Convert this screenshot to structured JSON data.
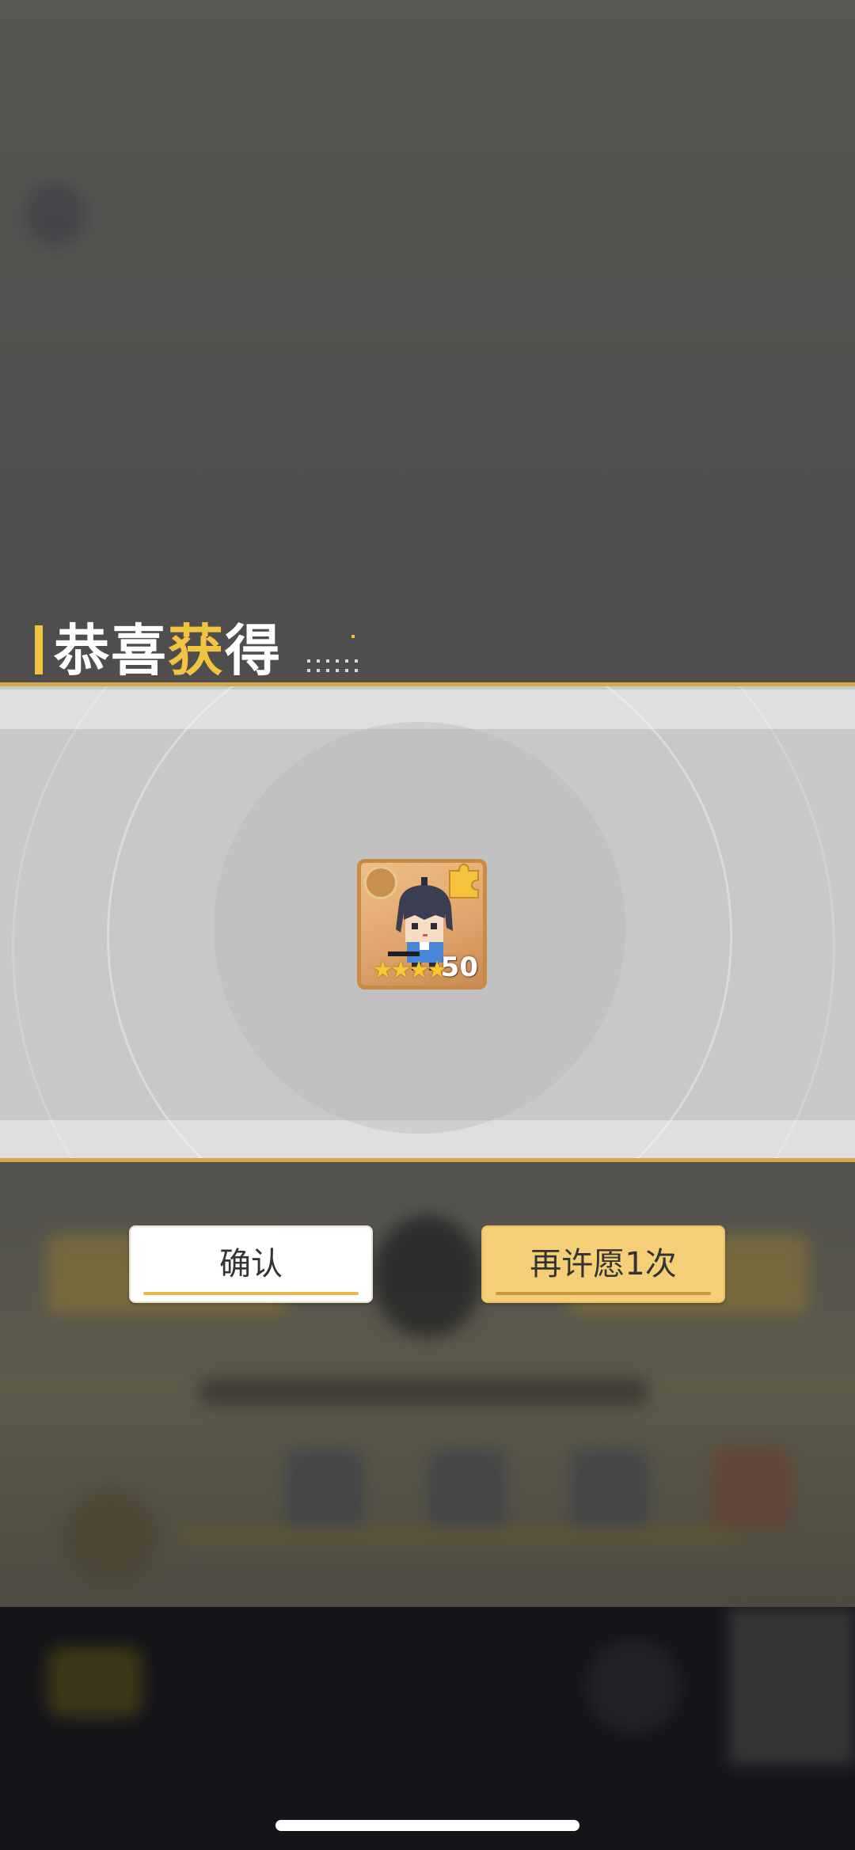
{
  "reward": {
    "title_white_1": "恭喜",
    "title_yellow": "获",
    "title_white_2": "得",
    "item": {
      "stars": "★★★★",
      "count": "50",
      "icon": "character-fragment-icon"
    }
  },
  "buttons": {
    "confirm_label": "确认",
    "again_label": "再许愿1次"
  },
  "colors": {
    "accent_gold": "#f2c340",
    "band_line": "#d6a84e",
    "again_button": "#f4cf77"
  }
}
